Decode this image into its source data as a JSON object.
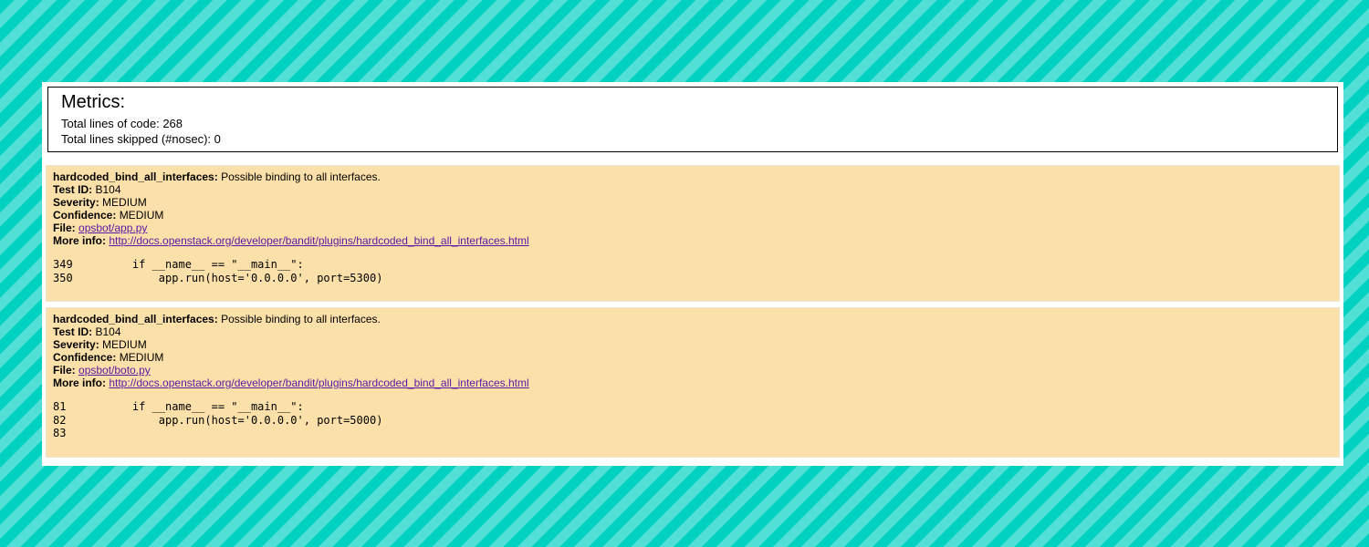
{
  "metrics": {
    "title": "Metrics:",
    "total_loc_label": "Total lines of code:",
    "total_loc": "268",
    "skipped_label": "Total lines skipped (#nosec):",
    "skipped": "0"
  },
  "labels": {
    "test_id": "Test ID:",
    "severity": "Severity:",
    "confidence": "Confidence:",
    "file": "File:",
    "more_info": "More info:"
  },
  "issues": [
    {
      "name": "hardcoded_bind_all_interfaces:",
      "description": "Possible binding to all interfaces.",
      "test_id": "B104",
      "severity": "MEDIUM",
      "confidence": "MEDIUM",
      "file": "opsbot/app.py",
      "more_info": "http://docs.openstack.org/developer/bandit/plugins/hardcoded_bind_all_interfaces.html",
      "code": [
        {
          "line": "349",
          "text": "    if __name__ == \"__main__\":"
        },
        {
          "line": "350",
          "text": "        app.run(host='0.0.0.0', port=5300)"
        }
      ]
    },
    {
      "name": "hardcoded_bind_all_interfaces:",
      "description": "Possible binding to all interfaces.",
      "test_id": "B104",
      "severity": "MEDIUM",
      "confidence": "MEDIUM",
      "file": "opsbot/boto.py",
      "more_info": "http://docs.openstack.org/developer/bandit/plugins/hardcoded_bind_all_interfaces.html",
      "code": [
        {
          "line": "81",
          "text": "    if __name__ == \"__main__\":"
        },
        {
          "line": "82",
          "text": "        app.run(host='0.0.0.0', port=5000)"
        },
        {
          "line": "83",
          "text": ""
        }
      ]
    }
  ]
}
